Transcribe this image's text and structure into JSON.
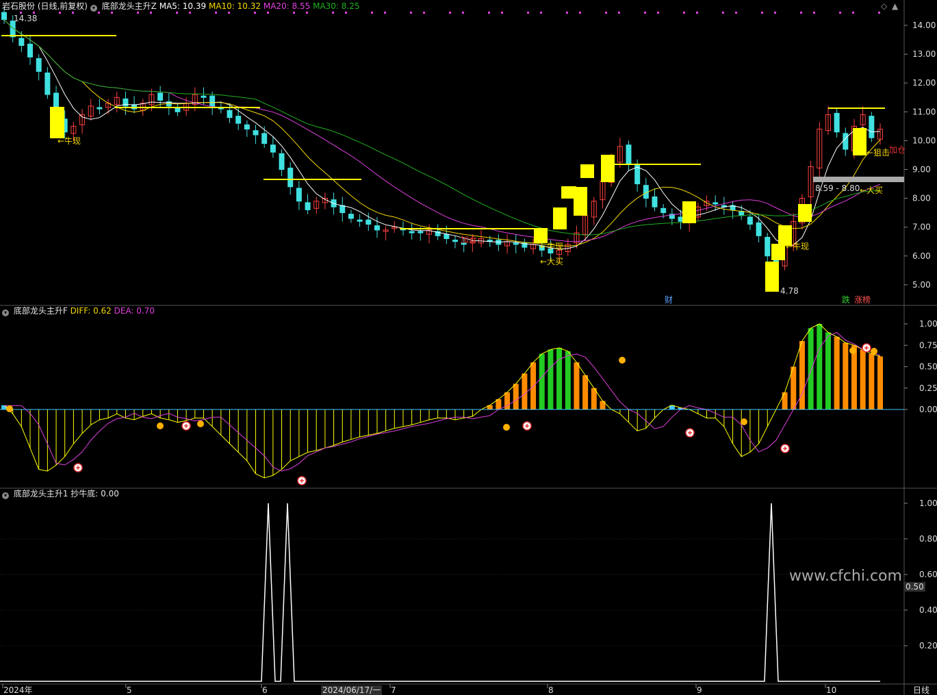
{
  "app": {
    "stock_title": "岩石股份 (日线,前复权)",
    "ind1_name": "底部龙头主升Z",
    "ind2_name": "底部龙头主升F",
    "ind3_name": "底部龙头主升1"
  },
  "ma_legend": [
    {
      "label": "MA5: 10.39",
      "color": "#ffffff"
    },
    {
      "label": "MA10: 10.32",
      "color": "#f5d800"
    },
    {
      "label": "MA20: 8.55",
      "color": "#e040e0"
    },
    {
      "label": "MA30: 8.25",
      "color": "#20b020"
    }
  ],
  "macd_legend": [
    {
      "label": "DIFF: 0.62",
      "color": "#f5d800"
    },
    {
      "label": "DEA: 0.70",
      "color": "#e040e0"
    }
  ],
  "bottom_legend": [
    {
      "label": "抄牛底: 0.00",
      "color": "#e6e6e6"
    }
  ],
  "watermark": "www.cfchi.com",
  "period_button": "日线",
  "crosshair_date": "2024/06/17/一",
  "badges": {
    "cai": "财",
    "die": "跌",
    "zhangbang": "涨榜"
  },
  "price_annotations": {
    "high_value": "14.38",
    "low_value": "4.78",
    "range_value": "8.59 - 8.80"
  },
  "signals": [
    {
      "text": "←牛现",
      "color": "#f5d800"
    },
    {
      "text": "←牛现",
      "color": "#f5d800"
    },
    {
      "text": "←大买",
      "color": "#f5d800"
    },
    {
      "text": "←牛现",
      "color": "#f5d800"
    },
    {
      "text": "←狙击",
      "color": "#f5d800"
    },
    {
      "text": "←大买",
      "color": "#f5d800"
    },
    {
      "text": "加仓",
      "color": "#e03030"
    },
    {
      "text": "加仓",
      "color": "#e03030"
    }
  ],
  "colors": {
    "up": "#ff4040",
    "down": "#40e0e0",
    "ma5": "#ffffff",
    "ma10": "#f5d800",
    "ma20": "#e040e0",
    "ma30": "#20b020",
    "signal_box": "#ffff00",
    "orange_bar": "#ff8c00",
    "green_bar": "#22cc22",
    "cyan_bar": "#40c8ff"
  },
  "chart_data": [
    {
      "type": "candlestick",
      "title": "岩石股份 (日线,前复权)",
      "y_ticks": [
        "14.00",
        "13.00",
        "12.00",
        "11.00",
        "10.00",
        "9.00",
        "8.00",
        "7.00",
        "6.00",
        "5.00"
      ],
      "ylim": [
        4.6,
        14.6
      ],
      "x_ticks": [
        "2024年",
        "5",
        "6",
        "7",
        "8",
        "9",
        "10"
      ],
      "legend": "top-left",
      "grid": false,
      "close_series": [
        14.2,
        13.6,
        13.3,
        12.9,
        12.4,
        11.6,
        10.8,
        10.3,
        10.5,
        10.9,
        11.2,
        11.1,
        11.3,
        11.5,
        11.2,
        11.1,
        11.3,
        11.6,
        11.4,
        11.2,
        11.0,
        11.3,
        11.6,
        11.5,
        11.2,
        11.1,
        10.8,
        10.6,
        10.4,
        10.2,
        9.9,
        9.6,
        9.0,
        8.4,
        7.9,
        7.6,
        7.9,
        8.0,
        7.7,
        7.5,
        7.3,
        7.2,
        7.1,
        6.9,
        6.9,
        7.0,
        6.9,
        6.8,
        6.8,
        6.9,
        6.7,
        6.6,
        6.5,
        6.4,
        6.5,
        6.6,
        6.5,
        6.4,
        6.5,
        6.4,
        6.3,
        6.4,
        6.2,
        6.1,
        6.2,
        6.4,
        6.8,
        7.4,
        7.9,
        8.6,
        9.3,
        9.8,
        9.2,
        8.5,
        8.0,
        7.7,
        7.5,
        7.3,
        7.2,
        7.4,
        7.7,
        7.9,
        7.8,
        7.7,
        7.6,
        7.4,
        7.1,
        6.7,
        6.0,
        5.6,
        6.4,
        7.2,
        8.0,
        9.1,
        10.4,
        10.9,
        10.3,
        9.7,
        10.5,
        10.9,
        10.1,
        10.4
      ]
    },
    {
      "type": "bar",
      "title": "底部龙头主升F",
      "y_ticks": [
        "1.00",
        "0.75",
        "0.50",
        "0.25",
        "0.00"
      ],
      "ylim": [
        -0.88,
        1.1
      ]
    },
    {
      "type": "line",
      "title": "底部龙头主升1",
      "y_ticks": [
        "1.00",
        "0.80",
        "0.60",
        "0.50",
        "0.40",
        "0.20"
      ],
      "ylim": [
        0,
        1
      ],
      "series": [
        {
          "name": "抄牛底",
          "values": [
            0,
            1,
            0,
            1,
            0,
            1,
            0
          ]
        }
      ]
    }
  ]
}
